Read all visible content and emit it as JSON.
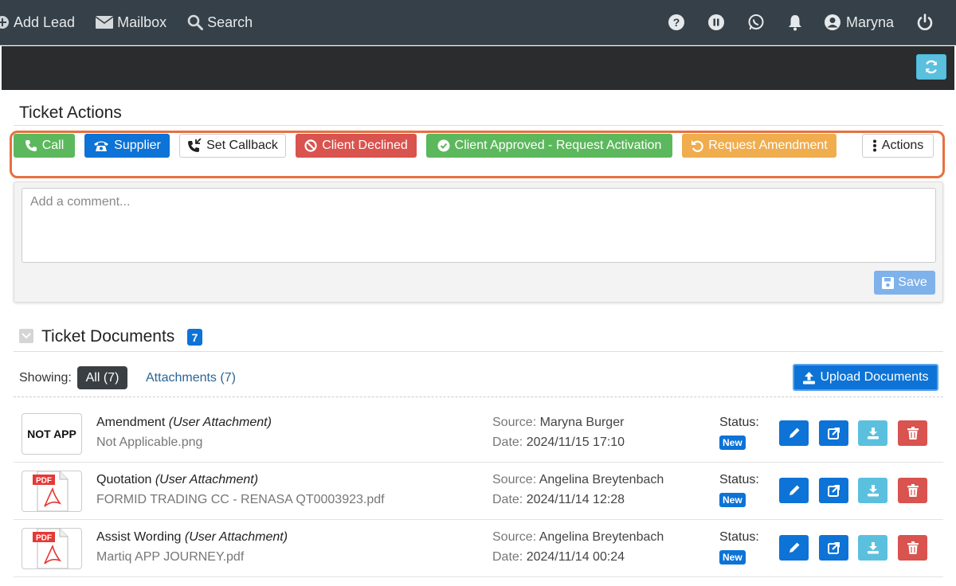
{
  "nav": {
    "add_lead": "Add Lead",
    "mailbox": "Mailbox",
    "search": "Search",
    "user": "Maryna"
  },
  "ticket_actions": {
    "title": "Ticket Actions",
    "buttons": {
      "call": "Call",
      "supplier": "Supplier",
      "set_callback": "Set Callback",
      "client_declined": "Client Declined",
      "client_approved": "Client Approved - Request Activation",
      "request_amendment": "Request Amendment",
      "actions": "Actions"
    }
  },
  "comment": {
    "placeholder": "Add a comment...",
    "save_label": "Save"
  },
  "documents": {
    "title": "Ticket Documents",
    "count": "7",
    "showing_label": "Showing:",
    "filter_all": "All (7)",
    "filter_attachments": "Attachments (7)",
    "upload_label": "Upload Documents",
    "source_label": "Source:",
    "date_label": "Date:",
    "status_label": "Status:",
    "rows": [
      {
        "thumb": "NOT APP",
        "thumb_type": "image",
        "name": "Amendment",
        "kind": "(User Attachment)",
        "file": "Not Applicable.png",
        "source": "Maryna Burger",
        "date": "2024/11/15 17:10",
        "status": "New"
      },
      {
        "thumb": "PDF",
        "thumb_type": "pdf",
        "name": "Quotation",
        "kind": "(User Attachment)",
        "file": "FORMID TRADING CC - RENASA QT0003923.pdf",
        "source": "Angelina Breytenbach",
        "date": "2024/11/14 12:28",
        "status": "New"
      },
      {
        "thumb": "PDF",
        "thumb_type": "pdf",
        "name": "Assist Wording",
        "kind": "(User Attachment)",
        "file": "Martiq APP JOURNEY.pdf",
        "source": "Angelina Breytenbach",
        "date": "2024/11/14 00:24",
        "status": "New"
      }
    ]
  },
  "colors": {
    "nav_bg": "#364048",
    "primary": "#0d73d6",
    "success": "#5cb85c",
    "danger": "#d9534f",
    "warning": "#f0ad4e",
    "info": "#5bc0de",
    "highlight": "#e8703f"
  }
}
